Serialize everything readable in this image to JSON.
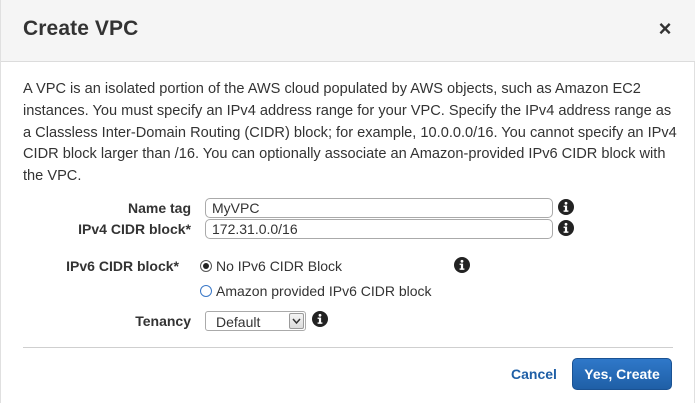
{
  "dialog": {
    "title": "Create VPC",
    "close_symbol": "×",
    "description": "A VPC is an isolated portion of the AWS cloud populated by AWS objects, such as Amazon EC2 instances. You must specify an IPv4 address range for your VPC. Specify the IPv4 address range as a Classless Inter-Domain Routing (CIDR) block; for example, 10.0.0.0/16. You cannot specify an IPv4 CIDR block larger than /16. You can optionally associate an Amazon-provided IPv6 CIDR block with the VPC."
  },
  "form": {
    "name_tag": {
      "label": "Name tag",
      "value": "MyVPC",
      "info_icon": "info-icon"
    },
    "ipv4_cidr": {
      "label": "IPv4 CIDR block*",
      "value": "172.31.0.0/16",
      "info_icon": "info-icon"
    },
    "ipv6_cidr": {
      "label": "IPv6 CIDR block*",
      "options": [
        {
          "label": "No IPv6 CIDR Block",
          "selected": true
        },
        {
          "label": "Amazon provided IPv6 CIDR block",
          "selected": false
        }
      ],
      "info_icon": "info-icon"
    },
    "tenancy": {
      "label": "Tenancy",
      "value": "Default",
      "info_icon": "info-icon"
    }
  },
  "actions": {
    "cancel_label": "Cancel",
    "create_label": "Yes, Create"
  },
  "colors": {
    "primary_button": "#1f5fa6",
    "link": "#1f5fa6",
    "header_bg": "#f5f5f5"
  }
}
